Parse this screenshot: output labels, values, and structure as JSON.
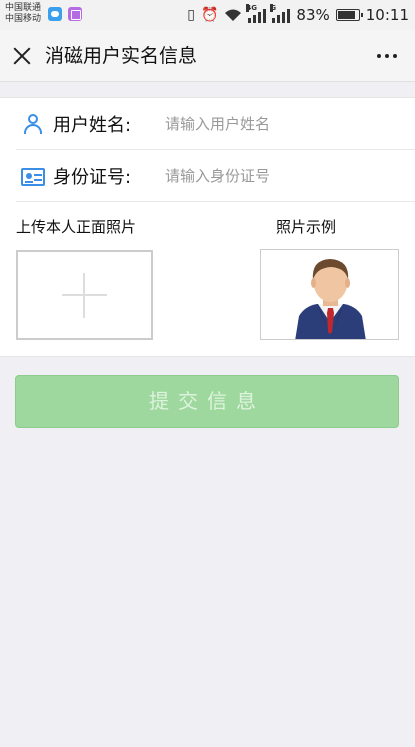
{
  "status_bar": {
    "carrier1": "中国联通",
    "carrier2": "中国移动",
    "network_tag": "4G",
    "network_tag2": "G",
    "battery": "83%",
    "time": "10:11"
  },
  "nav": {
    "title": "消磁用户实名信息"
  },
  "form": {
    "name_label": "用户姓名:",
    "name_placeholder": "请输入用户姓名",
    "id_label": "身份证号:",
    "id_placeholder": "请输入身份证号",
    "upload_label": "上传本人正面照片",
    "sample_label": "照片示例"
  },
  "submit_label": "提交信息",
  "colors": {
    "accent": "#3a8ee6",
    "submit_bg": "#9fd89f",
    "page_bg": "#efeff4"
  }
}
